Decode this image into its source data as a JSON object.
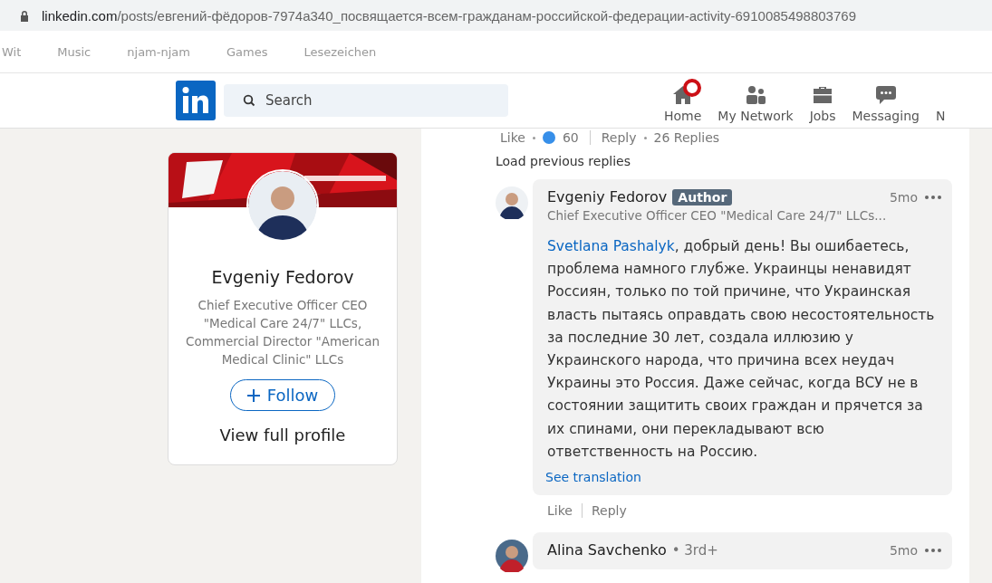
{
  "browser": {
    "url_domain": "linkedin.com",
    "url_path": "/posts/евгений-фёдоров-7974a340_посвящается-всем-гражданам-российской-федерации-activity-6910085498803769"
  },
  "bookmarks": [
    "Wit",
    "Music",
    "njam-njam",
    "Games",
    "Lesezeichen"
  ],
  "header": {
    "search": {
      "placeholder": "Search"
    },
    "nav": [
      {
        "label": "Home",
        "kind": "home",
        "badge": true
      },
      {
        "label": "My Network",
        "kind": "network",
        "badge": false
      },
      {
        "label": "Jobs",
        "kind": "jobs",
        "badge": false
      },
      {
        "label": "Messaging",
        "kind": "messaging",
        "badge": false
      },
      {
        "label": "N",
        "kind": "none",
        "badge": false
      }
    ]
  },
  "profile_card": {
    "name": "Evgeniy Fedorov",
    "headline": "Chief Executive Officer CEO \"Medical Care 24/7\" LLCs, Commercial Director \"American Medical Clinic\" LLCs",
    "follow": "Follow",
    "view_profile": "View full profile"
  },
  "parent_actions": {
    "like": "Like",
    "reactions": "60",
    "reply": "Reply",
    "replies": "26 Replies"
  },
  "load_previous": "Load previous replies",
  "comments": [
    {
      "name": "Evgeniy Fedorov",
      "badge": "Author",
      "headline": "Chief Executive Officer CEO \"Medical Care 24/7\" LLCs...",
      "time": "5mo",
      "text": "**Svetlana Pashalyk**, добрый день! Вы ошибаетесь, проблема намного глубже. Украинцы ненавидят Россиян, только по той причине, что Украинская власть пытаясь оправдать свою несостоятельность за последние 30 лет, создала иллюзию у Украинского народа, что причина всех неудач Украины это Россия. Даже сейчас, когда ВСУ не в состоянии защитить своих граждан и прячется за их спинами, они перекладывают всю ответственность на Россию.",
      "translation": "See translation",
      "like": "Like",
      "reply": "Reply"
    },
    {
      "name": "Alina Savchenko",
      "degree": "• 3rd+",
      "time": "5mo"
    }
  ]
}
